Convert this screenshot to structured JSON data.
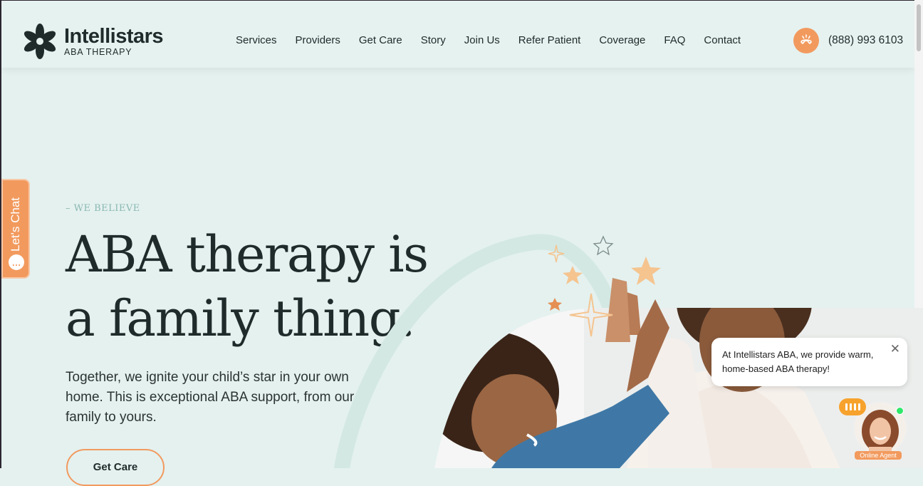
{
  "header": {
    "logo": {
      "name": "Intellistars",
      "subtitle": "ABA THERAPY"
    },
    "nav": [
      "Services",
      "Providers",
      "Get Care",
      "Story",
      "Join Us",
      "Refer Patient",
      "Coverage",
      "FAQ",
      "Contact"
    ],
    "phone": "(888) 993 6103"
  },
  "side_tab": {
    "label": "Let's Chat",
    "icon": "chat-bubble-icon"
  },
  "hero": {
    "eyebrow": "– WE BELIEVE",
    "headline_line1": "ABA therapy is",
    "headline_line2": "a family thing.",
    "lede": "Together, we ignite your child’s star in your own home. This is exceptional ABA support, from our family to yours.",
    "cta_label": "Get Care"
  },
  "chat_popup": {
    "text": "At Intellistars ABA, we provide warm, home-based ABA therapy!",
    "close_icon": "close-icon"
  },
  "agent": {
    "label": "Online Agent",
    "status": "online"
  },
  "colors": {
    "background": "#e4f1ef",
    "accent": "#f29a5e",
    "text": "#1f2b2a",
    "eyebrow": "#8bb8b1",
    "online": "#2ee86b"
  }
}
